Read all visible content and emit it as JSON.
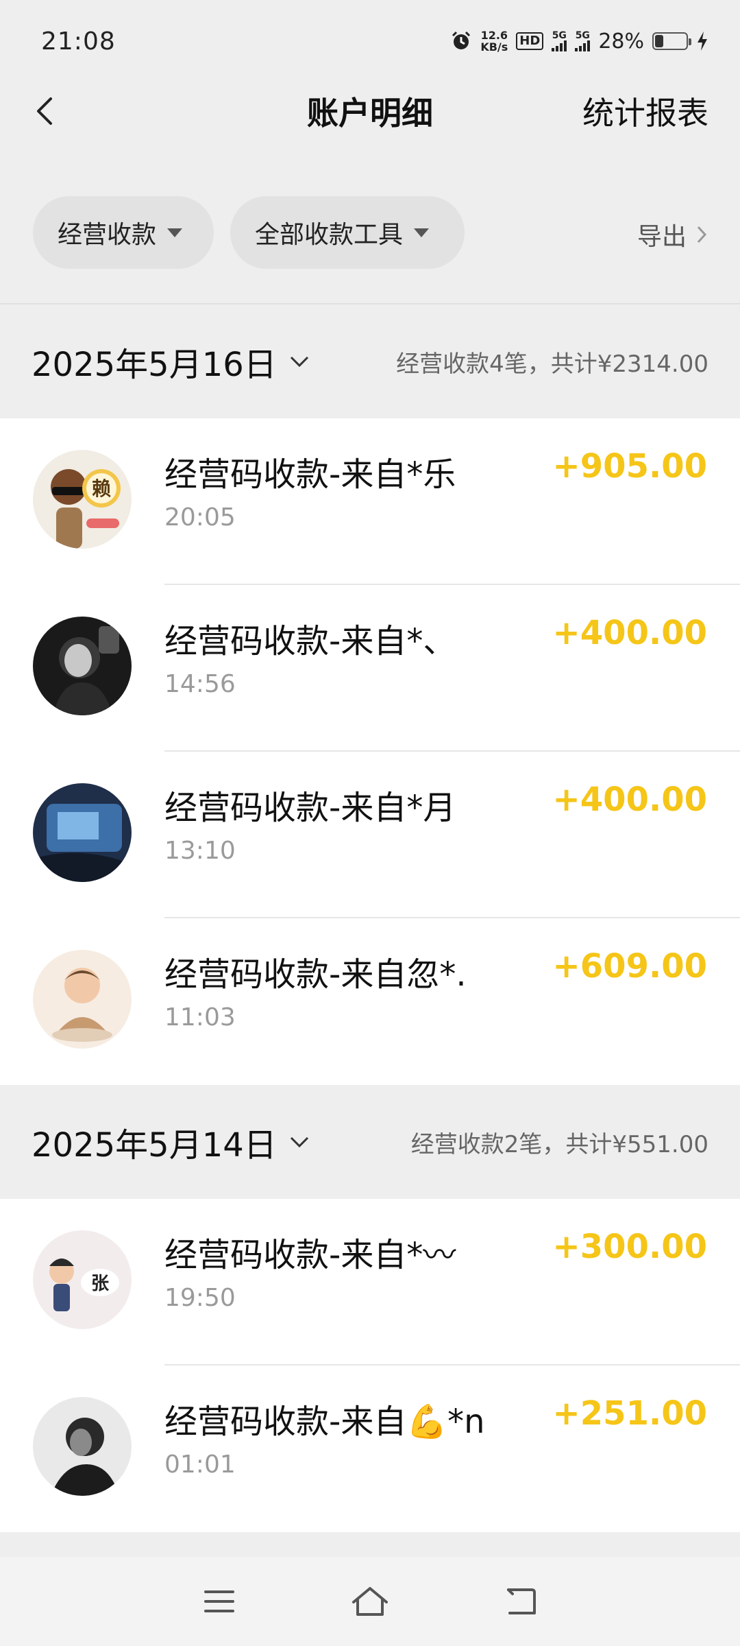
{
  "status": {
    "time": "21:08",
    "net_speed_value": "12.6",
    "net_speed_unit": "KB/s",
    "hd": "HD",
    "signal1": "5G",
    "signal2": "5G",
    "battery": "28%",
    "battery_level": 0.28
  },
  "header": {
    "title": "账户明细",
    "right_action": "统计报表"
  },
  "filters": {
    "type": "经营收款",
    "tool": "全部收款工具",
    "export": "导出"
  },
  "groups": [
    {
      "date": "2025年5月16日",
      "summary": "经营收款4笔，共计¥2314.00",
      "items": [
        {
          "title": "经营码收款-来自*乐",
          "time": "20:05",
          "amount": "+905.00",
          "avatar_text": "赖"
        },
        {
          "title": "经营码收款-来自*、",
          "time": "14:56",
          "amount": "+400.00"
        },
        {
          "title": "经营码收款-来自*月",
          "time": "13:10",
          "amount": "+400.00"
        },
        {
          "title": "经营码收款-来自忽*.",
          "time": "11:03",
          "amount": "+609.00"
        }
      ]
    },
    {
      "date": "2025年5月14日",
      "summary": "经营收款2笔，共计¥551.00",
      "items": [
        {
          "title": "经营码收款-来自*〰",
          "time": "19:50",
          "amount": "+300.00",
          "avatar_text": "张"
        },
        {
          "title": "经营码收款-来自💪*n",
          "time": "01:01",
          "amount": "+251.00"
        }
      ]
    }
  ],
  "colors": {
    "amount": "#f5c518",
    "background": "#eeeeee"
  }
}
